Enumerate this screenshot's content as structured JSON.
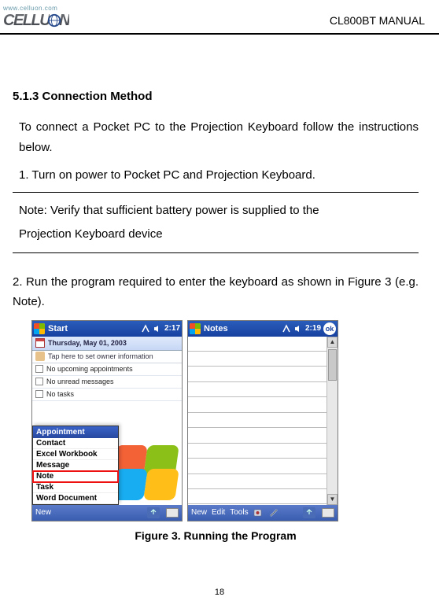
{
  "header": {
    "logo_url": "www.celluon.com",
    "logo_left": "CELLU",
    "logo_right": "N",
    "doc_title": "CL800BT MANUAL"
  },
  "section": {
    "number_title": "5.1.3 Connection Method",
    "intro": "To connect a Pocket PC to the Projection Keyboard follow the instructions below.",
    "step1": "1. Turn on power to Pocket PC and Projection Keyboard.",
    "note_line1": "Note: Verify that sufficient battery power is supplied to the",
    "note_line2": "Projection Keyboard device",
    "step2": "2. Run the program required to enter the keyboard as shown in Figure 3 (e.g. Note).",
    "figure_caption": "Figure 3. Running the Program"
  },
  "screens": {
    "left": {
      "title": "Start",
      "time": "2:17",
      "date": "Thursday, May 01, 2003",
      "owner": "Tap here to set owner information",
      "rows": [
        "No upcoming appointments",
        "No unread messages",
        "No tasks"
      ],
      "popup_header": "Appointment",
      "popup_items": [
        "Contact",
        "Excel Workbook",
        "Message",
        "Note",
        "Task",
        "Word Document"
      ],
      "highlight_index": 3,
      "bottom_label": "New"
    },
    "right": {
      "title": "Notes",
      "time": "2:19",
      "ok": "ok",
      "bottom_labels": [
        "New",
        "Edit",
        "Tools"
      ]
    }
  },
  "page_number": "18"
}
